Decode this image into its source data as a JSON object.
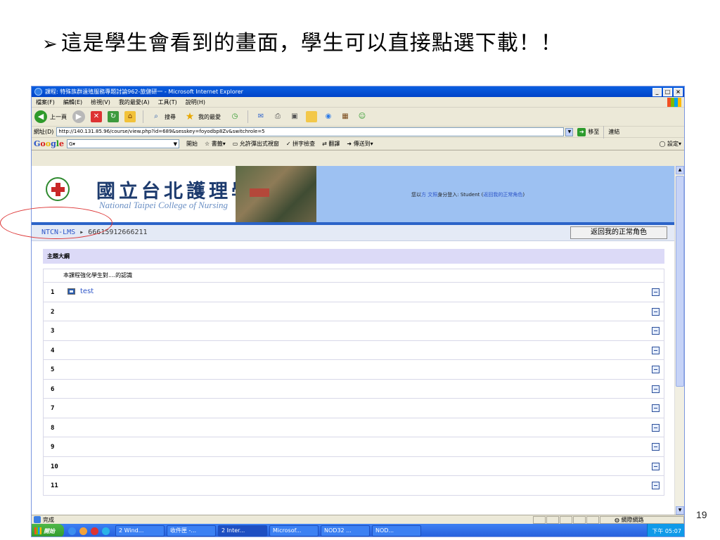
{
  "slide": {
    "title": "這是學生會看到的畫面，學生可以直接點選下載！！",
    "bullet": "➢",
    "page_number": "19"
  },
  "window": {
    "title": "課程: 特殊族群遠殖服務專題討論962-旅健研一 - Microsoft Internet Explorer",
    "menu": [
      "檔案(F)",
      "編輯(E)",
      "檢視(V)",
      "我的最愛(A)",
      "工具(T)",
      "說明(H)"
    ],
    "toolbar": {
      "back": "上一頁",
      "search": "搜尋",
      "favorites": "我的最愛"
    },
    "address": {
      "label": "網址(D)",
      "url": "http://140.131.85.96/course/view.php?id=689&sesskey=foyodbp8Zv&switchrole=5",
      "go": "移至",
      "links": "連結"
    },
    "google": {
      "logo_letters": [
        "G",
        "o",
        "o",
        "g",
        "l",
        "e"
      ],
      "search_box": "G▾",
      "start": "開始",
      "bookmarks": "書籤▾",
      "popup": "允許彈出式視窗",
      "spellcheck": "拼字檢查",
      "translate": "翻譯",
      "sendto": "傳送到▾",
      "settings": "設定▾"
    },
    "status": "完成",
    "zone": "網際網路"
  },
  "page": {
    "school_cn": "國立台北護理學院",
    "school_en": "National Taipei College of Nursing",
    "login_prefix": "您以",
    "login_user": "方 文照",
    "login_role": "身分登入: Student (",
    "login_return": "返回我的正常角色",
    "login_suffix": ")",
    "breadcrumb_home": "NTCN-LMS",
    "breadcrumb_sep": "▸",
    "breadcrumb_course": "66615912666211",
    "return_role_button": "返回我的正常角色",
    "topic_outline": "主題大綱",
    "course_intro": "本課程強化學生對....的認識",
    "topics": [
      {
        "num": "1",
        "resource": "test"
      },
      {
        "num": "2",
        "resource": ""
      },
      {
        "num": "3",
        "resource": ""
      },
      {
        "num": "4",
        "resource": ""
      },
      {
        "num": "5",
        "resource": ""
      },
      {
        "num": "6",
        "resource": ""
      },
      {
        "num": "7",
        "resource": ""
      },
      {
        "num": "8",
        "resource": ""
      },
      {
        "num": "9",
        "resource": ""
      },
      {
        "num": "10",
        "resource": ""
      },
      {
        "num": "11",
        "resource": ""
      }
    ]
  },
  "taskbar": {
    "start": "開始",
    "tasks": [
      "2 Wind...",
      "收件匣 -...",
      "2 Inter...",
      "Microsof...",
      "NOD32 ...",
      "NOD..."
    ],
    "clock": "下午 05:07"
  },
  "colors": {
    "header_bg": "#9dc1f2",
    "accent_blue": "#2b63c8",
    "link": "#2d55c8",
    "topic_header_bg": "#dcdaf7",
    "highlight": "#dd3333"
  }
}
